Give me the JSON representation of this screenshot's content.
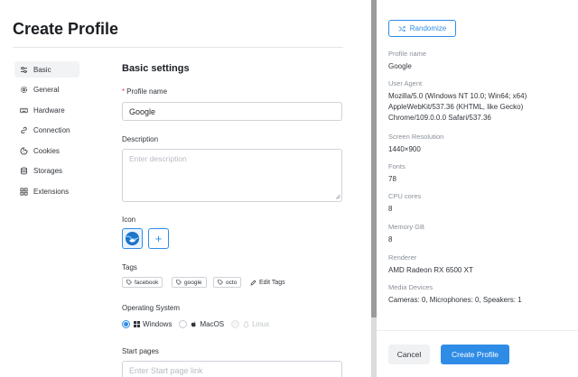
{
  "header": {
    "title": "Create Profile"
  },
  "sidebar": {
    "items": [
      {
        "label": "Basic",
        "icon": "sliders-icon",
        "active": true
      },
      {
        "label": "General",
        "icon": "gear-icon"
      },
      {
        "label": "Hardware",
        "icon": "keyboard-icon"
      },
      {
        "label": "Connection",
        "icon": "link-icon"
      },
      {
        "label": "Cookies",
        "icon": "cookie-icon"
      },
      {
        "label": "Storages",
        "icon": "database-icon"
      },
      {
        "label": "Extensions",
        "icon": "grid-icon"
      }
    ]
  },
  "form": {
    "section_title": "Basic settings",
    "profile_name": {
      "label": "Profile name",
      "required_mark": "*",
      "value": "Google"
    },
    "description": {
      "label": "Description",
      "placeholder": "Enter description"
    },
    "icon": {
      "label": "Icon",
      "add_label": "+"
    },
    "tags": {
      "label": "Tags",
      "items": [
        "facebook",
        "google",
        "octo"
      ],
      "edit_label": "Edit Tags"
    },
    "os": {
      "label": "Operating System",
      "options": [
        {
          "label": "Windows",
          "checked": true,
          "icon": "windows-icon"
        },
        {
          "label": "MacOS",
          "checked": false,
          "icon": "apple-icon"
        },
        {
          "label": "Linux",
          "checked": false,
          "disabled": true,
          "icon": "linux-icon"
        }
      ]
    },
    "start_pages": {
      "label": "Start pages",
      "placeholder": "Enter Start page link"
    }
  },
  "summary": {
    "randomize_label": "Randomize",
    "fields": [
      {
        "label": "Profile name",
        "value": "Google"
      },
      {
        "label": "User Agent",
        "value": "Mozilla/5.0 (Windows NT 10.0; Win64; x64) AppleWebKit/537.36 (KHTML, like Gecko) Chrome/109.0.0.0 Safari/537.36"
      },
      {
        "label": "Screen Resolution",
        "value": "1440×900"
      },
      {
        "label": "Fonts",
        "value": "78"
      },
      {
        "label": "CPU cores",
        "value": "8"
      },
      {
        "label": "Memory GB",
        "value": "8"
      },
      {
        "label": "Renderer",
        "value": "AMD Radeon RX 6500 XT"
      },
      {
        "label": "Media Devices",
        "value": "Cameras: 0, Microphones: 0, Speakers: 1"
      }
    ]
  },
  "footer": {
    "cancel_label": "Cancel",
    "create_label": "Create Profile"
  },
  "colors": {
    "accent": "#2f8ce6",
    "required": "#e5484d",
    "text": "#30343a",
    "muted": "#8a9099"
  }
}
